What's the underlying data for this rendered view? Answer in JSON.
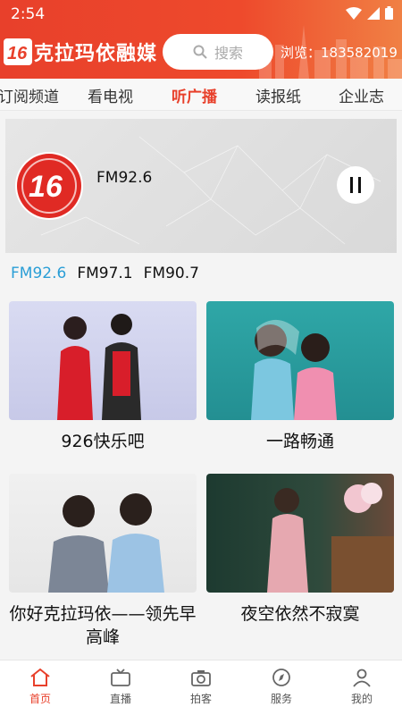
{
  "status": {
    "time": "2:54"
  },
  "header": {
    "logo_text": "克拉玛依融媒",
    "search_placeholder": "搜索",
    "views_label": "浏览：183582019"
  },
  "tabs": [
    {
      "label": "订阅频道"
    },
    {
      "label": "看电视"
    },
    {
      "label": "听广播"
    },
    {
      "label": "读报纸"
    },
    {
      "label": "企业志"
    }
  ],
  "player": {
    "now_playing": "FM92.6"
  },
  "frequencies": [
    {
      "label": "FM92.6"
    },
    {
      "label": "FM97.1"
    },
    {
      "label": "FM90.7"
    }
  ],
  "programs": [
    {
      "title": "926快乐吧"
    },
    {
      "title": "一路畅通"
    },
    {
      "title": "你好克拉玛依——领先早高峰"
    },
    {
      "title": "夜空依然不寂寞"
    }
  ],
  "bottom_nav": [
    {
      "label": "首页",
      "icon": "home-icon"
    },
    {
      "label": "直播",
      "icon": "tv-icon"
    },
    {
      "label": "拍客",
      "icon": "camera-icon"
    },
    {
      "label": "服务",
      "icon": "compass-icon"
    },
    {
      "label": "我的",
      "icon": "user-icon"
    }
  ],
  "colors": {
    "brand": "#e8402b",
    "active_freq": "#2a9ed6"
  }
}
